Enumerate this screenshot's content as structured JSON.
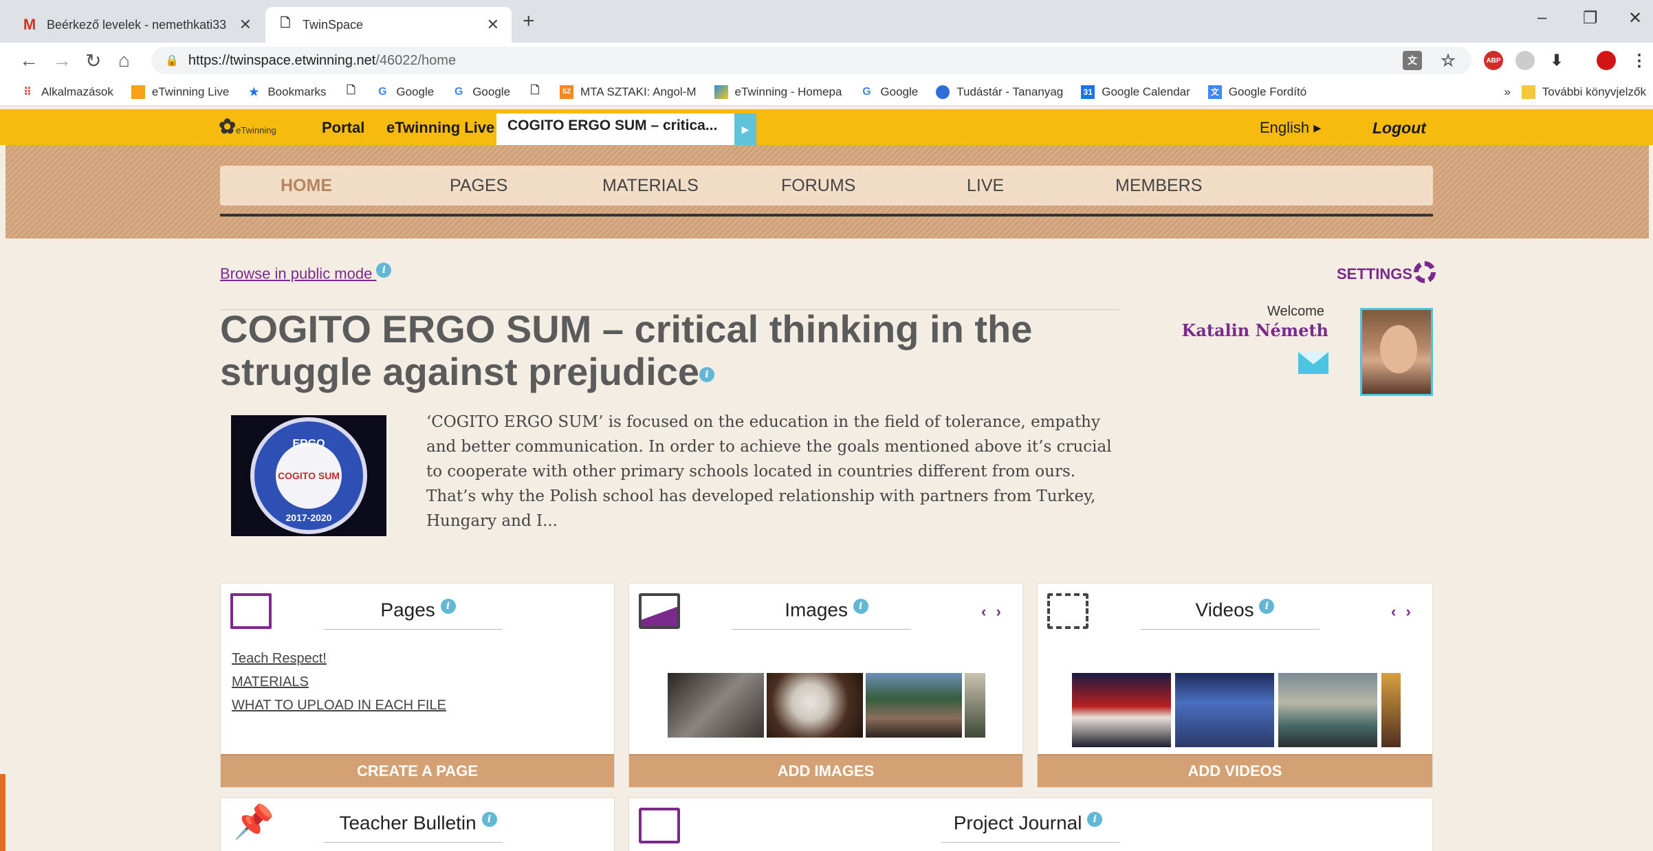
{
  "browser": {
    "tabs": [
      {
        "label": "Beérkező levelek - nemethkati33",
        "icon": "gmail-icon",
        "active": false
      },
      {
        "label": "TwinSpace",
        "icon": "page-icon",
        "active": true
      }
    ],
    "url_host": "https://twinspace.etwinning.net",
    "url_path": "/46022/home",
    "bookmarks": [
      {
        "label": "Alkalmazások",
        "icon": "apps-grid-icon"
      },
      {
        "label": "eTwinning Live",
        "icon": "etwinning-icon"
      },
      {
        "label": "Bookmarks",
        "icon": "star-icon"
      },
      {
        "label": "",
        "icon": "page-icon"
      },
      {
        "label": "Google",
        "icon": "google-icon"
      },
      {
        "label": "Google",
        "icon": "google-icon"
      },
      {
        "label": "",
        "icon": "page-icon"
      },
      {
        "label": "MTA SZTAKI: Angol-M",
        "icon": "sztaki-icon"
      },
      {
        "label": "eTwinning - Homepa",
        "icon": "etwinning-icon"
      },
      {
        "label": "Google",
        "icon": "google-icon"
      },
      {
        "label": "Tudástár - Tananyag",
        "icon": "tudastar-icon"
      },
      {
        "label": "Google Calendar",
        "icon": "calendar-icon"
      },
      {
        "label": "Google Fordító",
        "icon": "translate-icon"
      }
    ],
    "more_bookmarks": "»",
    "other_bookmarks": "További könyvjelzők"
  },
  "etwinning": {
    "logo_text": "eTwinning",
    "portal": "Portal",
    "live": "eTwinning Live",
    "project_short": "COGITO ERGO SUM – critica...",
    "language": "English ▸",
    "logout": "Logout"
  },
  "nav": [
    "HOME",
    "PAGES",
    "MATERIALS",
    "FORUMS",
    "LIVE",
    "MEMBERS"
  ],
  "content": {
    "browse_public": "Browse in public mode",
    "settings": "SETTINGS",
    "project_title": "COGITO ERGO SUM – critical thinking in the struggle against prejudice",
    "welcome": "Welcome",
    "user_name": "Katalin Németh",
    "logo_top": "ERGO",
    "logo_left": "COGITO",
    "logo_right": "SUM",
    "logo_years": "2017-2020",
    "description": "‘COGITO ERGO SUM’ is focused on the education in the field of tolerance, empathy and better communication. In order to achieve the goals mentioned above it’s crucial to cooperate with other primary schools located in countries different from ours. That’s why the Polish school has developed relationship with partners from Turkey, Hungary and I..."
  },
  "cards": {
    "pages": {
      "title": "Pages",
      "links": [
        "Teach Respect!",
        "MATERIALS",
        "WHAT TO UPLOAD IN EACH FILE"
      ],
      "footer": "CREATE A PAGE"
    },
    "images": {
      "title": "Images",
      "arrows": "‹ ›",
      "footer": "ADD IMAGES"
    },
    "videos": {
      "title": "Videos",
      "arrows": "‹ ›",
      "footer": "ADD VIDEOS"
    },
    "bulletin": {
      "title": "Teacher Bulletin"
    },
    "journal": {
      "title": "Project Journal"
    }
  },
  "colors": {
    "etwinning_yellow": "#f7bb10",
    "accent_purple": "#7a2a8c",
    "info_blue": "#62b7d4",
    "button_tan": "#d4a174"
  }
}
